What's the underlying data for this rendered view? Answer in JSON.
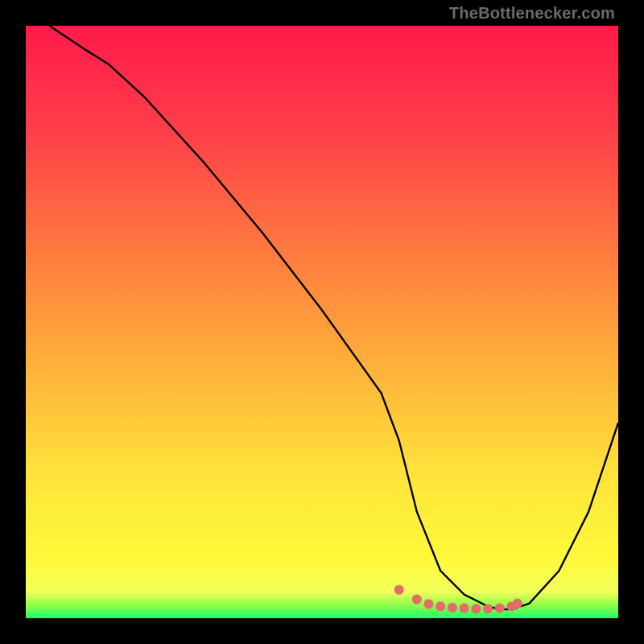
{
  "watermark": "TheBottlenecker.com",
  "gradient": {
    "stops": [
      {
        "offset": 0.0,
        "color": "#ff1a4a"
      },
      {
        "offset": 0.18,
        "color": "#ff3f4a"
      },
      {
        "offset": 0.38,
        "color": "#ff7a3f"
      },
      {
        "offset": 0.58,
        "color": "#ffb23a"
      },
      {
        "offset": 0.75,
        "color": "#ffe23a"
      },
      {
        "offset": 0.9,
        "color": "#fff93a"
      },
      {
        "offset": 0.955,
        "color": "#f2ff5a"
      },
      {
        "offset": 0.975,
        "color": "#9dff4a"
      },
      {
        "offset": 1.0,
        "color": "#1aff66"
      }
    ]
  },
  "chart_data": {
    "type": "line",
    "title": "",
    "xlabel": "",
    "ylabel": "",
    "xlim": [
      0,
      100
    ],
    "ylim": [
      0,
      100
    ],
    "series": [
      {
        "name": "curve",
        "color": "#000000",
        "x": [
          4,
          7,
          10,
          14,
          20,
          30,
          40,
          50,
          60,
          63,
          66,
          70,
          74,
          78,
          80,
          82,
          85,
          90,
          95,
          100
        ],
        "y": [
          100,
          98,
          96,
          93.5,
          88,
          77,
          65,
          52,
          38,
          30,
          18,
          8,
          4,
          2,
          1.5,
          1.5,
          2.5,
          8,
          18,
          33
        ]
      },
      {
        "name": "markers",
        "color": "#e66a6a",
        "type": "scatter",
        "x": [
          63,
          66,
          68,
          70,
          72,
          74,
          76,
          78,
          80,
          82,
          83
        ],
        "y": [
          4.8,
          3.2,
          2.4,
          2.0,
          1.8,
          1.7,
          1.6,
          1.6,
          1.7,
          2.0,
          2.5
        ]
      }
    ]
  }
}
